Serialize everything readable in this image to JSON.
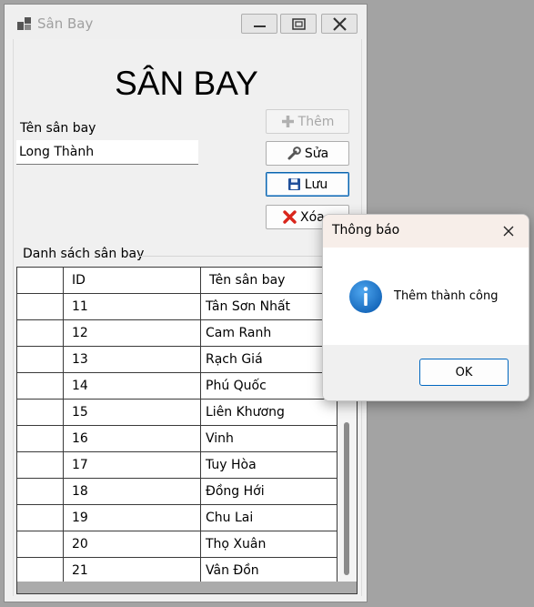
{
  "window": {
    "title": "Sân Bay",
    "heading": "SÂN BAY"
  },
  "form": {
    "name_label": "Tên sân bay",
    "name_value": "Long Thành"
  },
  "buttons": {
    "add": "Thêm",
    "edit": "Sửa",
    "save": "Lưu",
    "delete": "Xóa"
  },
  "list": {
    "group_label": "Danh sách sân bay",
    "columns": [
      "",
      "ID",
      "Tên sân bay"
    ],
    "rows": [
      {
        "id": "11",
        "name": "Tân Sơn Nhất"
      },
      {
        "id": "12",
        "name": "Cam Ranh"
      },
      {
        "id": "13",
        "name": "Rạch Giá"
      },
      {
        "id": "14",
        "name": "Phú Quốc"
      },
      {
        "id": "15",
        "name": "Liên Khương"
      },
      {
        "id": "16",
        "name": "Vinh"
      },
      {
        "id": "17",
        "name": "Tuy Hòa"
      },
      {
        "id": "18",
        "name": "Đồng Hới"
      },
      {
        "id": "19",
        "name": "Chu Lai"
      },
      {
        "id": "20",
        "name": "Thọ Xuân"
      },
      {
        "id": "21",
        "name": "Vân Đồn"
      }
    ]
  },
  "dialog": {
    "title": "Thông báo",
    "message": "Thêm thành công",
    "ok_label": "OK"
  },
  "colors": {
    "info_icon": "#1e7fd6",
    "delete_icon": "#d9261c",
    "save_icon": "#1f4f9a",
    "accent": "#0067c0"
  }
}
